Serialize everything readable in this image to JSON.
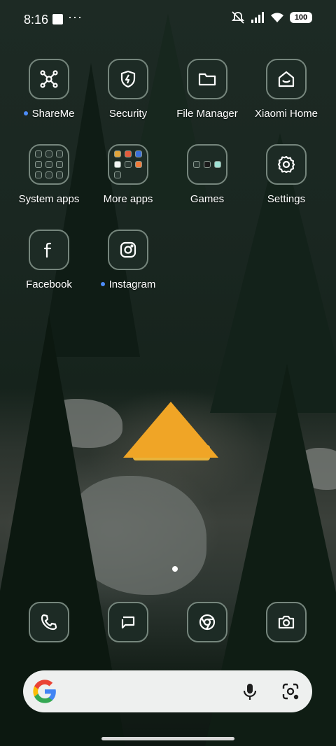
{
  "status_bar": {
    "time": "8:16",
    "notification_icons": [
      "square-notification-icon",
      "more-dots-icon"
    ],
    "overflow": "···",
    "system_icons": [
      "mute-icon",
      "signal-icon",
      "wifi-icon"
    ],
    "battery": "100"
  },
  "apps": [
    {
      "label": "ShareMe",
      "icon": "shareme-icon",
      "new_dot": true
    },
    {
      "label": "Security",
      "icon": "shield-icon",
      "new_dot": false
    },
    {
      "label": "File Manager",
      "icon": "folder-icon",
      "new_dot": false
    },
    {
      "label": "Xiaomi Home",
      "icon": "home-icon",
      "new_dot": false
    },
    {
      "label": "System apps",
      "icon": "folder-grid",
      "new_dot": false
    },
    {
      "label": "More apps",
      "icon": "folder-grid",
      "new_dot": false
    },
    {
      "label": "Games",
      "icon": "folder-grid",
      "new_dot": false
    },
    {
      "label": "Settings",
      "icon": "gear-icon",
      "new_dot": false
    },
    {
      "label": "Facebook",
      "icon": "facebook-icon",
      "new_dot": false
    },
    {
      "label": "Instagram",
      "icon": "instagram-icon",
      "new_dot": true
    }
  ],
  "dock": [
    {
      "name": "Phone",
      "icon": "phone-icon"
    },
    {
      "name": "Messages",
      "icon": "message-icon"
    },
    {
      "name": "Chrome",
      "icon": "chrome-icon"
    },
    {
      "name": "Camera",
      "icon": "camera-icon"
    }
  ],
  "search_bar": {
    "logo": "google-icon",
    "mic": "microphone-icon",
    "lens": "lens-icon"
  },
  "page_indicator": {
    "current": 1,
    "total": 1
  },
  "colors": {
    "notification_dot": "#4d8dfa",
    "icon_bg": "#1d2b25",
    "icon_border": "#76867d"
  }
}
